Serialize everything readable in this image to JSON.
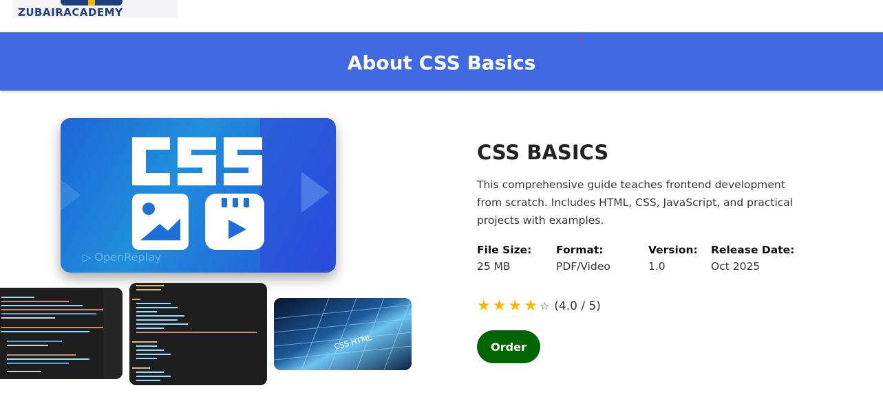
{
  "header": {
    "logo_text": "ZUBAIRACADEMY"
  },
  "banner": {
    "title": "About CSS Basics"
  },
  "product": {
    "hero_image_text": "CSS",
    "watermark": "OpenReplay",
    "thumbnail_3_text": "CSS HTML",
    "title": "CSS BASICS",
    "description": "This comprehensive guide teaches frontend development from scratch. Includes HTML, CSS, JavaScript, and practical projects with examples.",
    "file_size_label": "File Size:",
    "file_size_value": "25 MB",
    "format_label": "Format:",
    "format_value": "PDF/Video",
    "version_label": "Version:",
    "version_value": "1.0",
    "release_label": "Release Date:",
    "release_value": "Oct 2025",
    "rating_value": 4.0,
    "rating_max": 5,
    "rating_text": "(4.0 / 5)",
    "order_label": "Order"
  },
  "colors": {
    "banner": "#4169e1",
    "order_button": "#006400",
    "star": "#f2b705"
  }
}
